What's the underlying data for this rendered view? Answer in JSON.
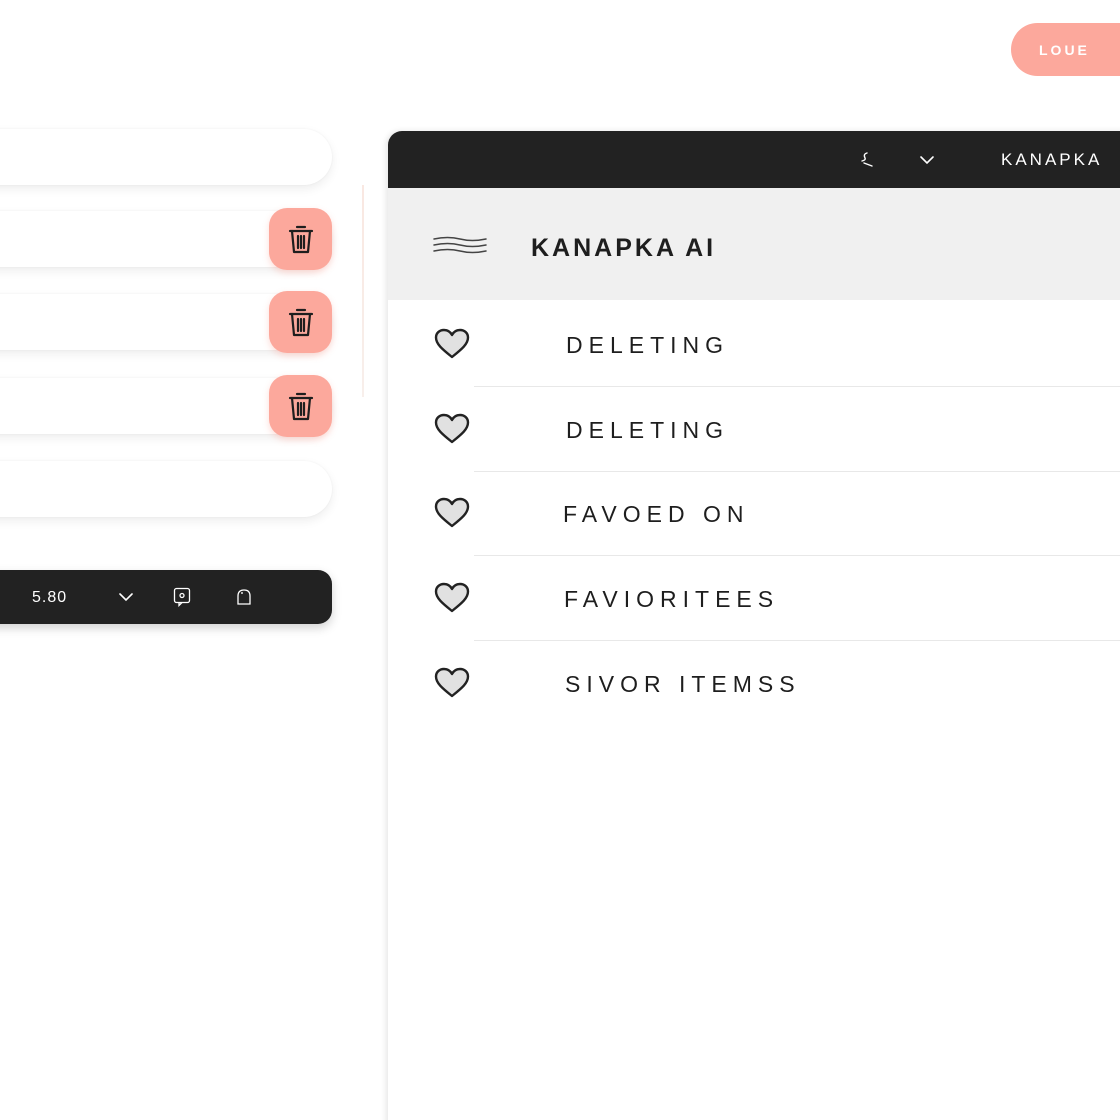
{
  "top_button": {
    "label": "LOUE"
  },
  "left_list": {
    "rows": [
      {
        "has_delete": false
      },
      {
        "has_delete": true
      },
      {
        "has_delete": true
      },
      {
        "has_delete": true
      },
      {
        "has_delete": false
      }
    ]
  },
  "bottom_bar": {
    "price": "5.80",
    "icons": [
      "chevron-down-icon",
      "chat-icon",
      "bag-icon"
    ]
  },
  "panel": {
    "topbar": {
      "brand": "KANAPKA",
      "icons": [
        "search-icon",
        "chevron-down-icon"
      ]
    },
    "header": {
      "title": "KANAPKA AI"
    },
    "items": [
      {
        "label": "DELETING"
      },
      {
        "label": "DELETING"
      },
      {
        "label": "FAVOED ON"
      },
      {
        "label": "FAVIORITEES"
      },
      {
        "label": "SIVOR ITEMSS"
      }
    ]
  },
  "colors": {
    "accent": "#fca89c",
    "dark": "#222222",
    "header_bg": "#f0f0f0"
  }
}
